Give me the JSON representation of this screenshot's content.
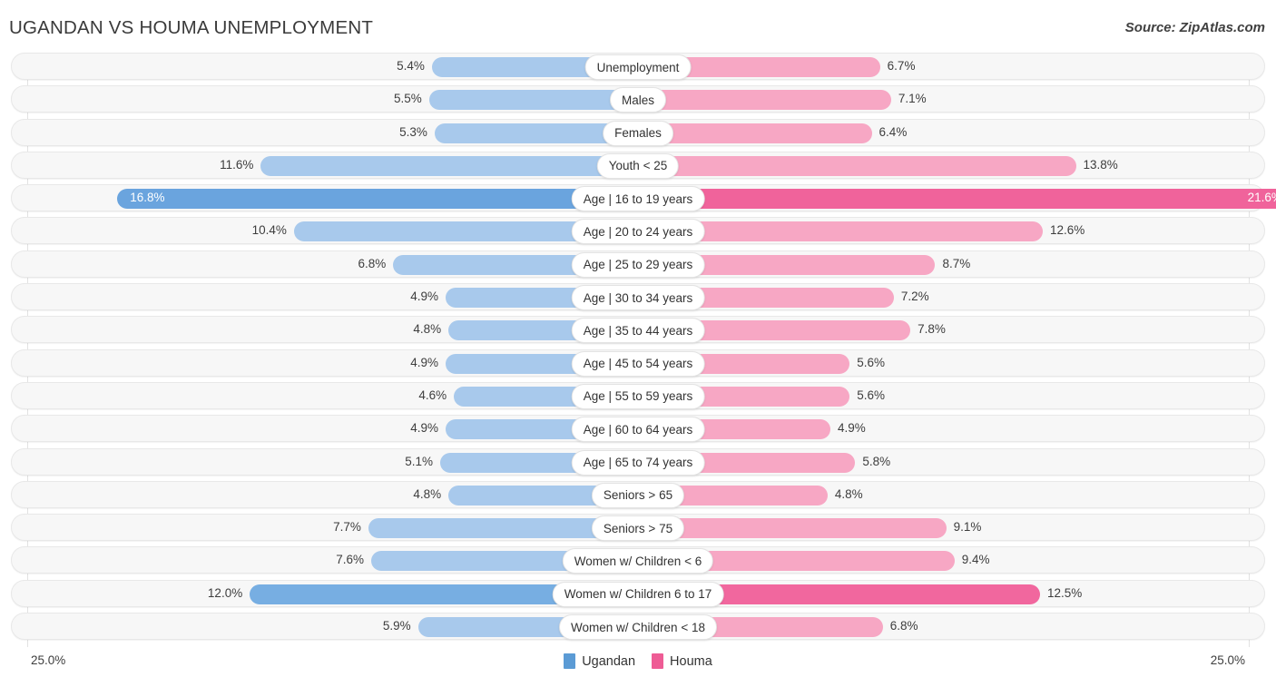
{
  "header": {
    "title": "UGANDAN VS HOUMA UNEMPLOYMENT",
    "source": "Source: ZipAtlas.com"
  },
  "footer": {
    "axis_left": "25.0%",
    "axis_right": "25.0%",
    "legend": [
      {
        "label": "Ugandan",
        "color": "#5b9bd5"
      },
      {
        "label": "Houma",
        "color": "#ee5c95"
      }
    ]
  },
  "chart_data": {
    "type": "bar",
    "subtype": "diverging-bidirectional",
    "title": "UGANDAN VS HOUMA UNEMPLOYMENT",
    "xlabel": "",
    "ylabel": "",
    "xlim": [
      -25.0,
      25.0
    ],
    "axis_tick_labels": [
      "25.0%",
      "25.0%"
    ],
    "grid": true,
    "legend_position": "bottom-center",
    "series": [
      {
        "name": "Ugandan",
        "color": "#5b9bd5",
        "side": "left",
        "values": [
          5.4,
          5.5,
          5.3,
          11.6,
          16.8,
          10.4,
          6.8,
          4.9,
          4.8,
          4.9,
          4.6,
          4.9,
          5.1,
          4.8,
          7.7,
          7.6,
          12.0,
          5.9
        ]
      },
      {
        "name": "Houma",
        "color": "#ee5c95",
        "side": "right",
        "values": [
          6.7,
          7.1,
          6.4,
          13.8,
          21.6,
          12.6,
          8.7,
          7.2,
          7.8,
          5.6,
          5.6,
          4.9,
          5.8,
          4.8,
          9.1,
          9.4,
          12.5,
          6.8
        ]
      }
    ],
    "categories": [
      "Unemployment",
      "Males",
      "Females",
      "Youth < 25",
      "Age | 16 to 19 years",
      "Age | 20 to 24 years",
      "Age | 25 to 29 years",
      "Age | 30 to 34 years",
      "Age | 35 to 44 years",
      "Age | 45 to 54 years",
      "Age | 55 to 59 years",
      "Age | 60 to 64 years",
      "Age | 65 to 74 years",
      "Seniors > 65",
      "Seniors > 75",
      "Women w/ Children < 6",
      "Women w/ Children 6 to 17",
      "Women w/ Children < 18"
    ],
    "rows": [
      {
        "label": "Unemployment",
        "left": 5.4,
        "right": 6.7,
        "left_text": "5.4%",
        "right_text": "6.7%",
        "style": "normal"
      },
      {
        "label": "Males",
        "left": 5.5,
        "right": 7.1,
        "left_text": "5.5%",
        "right_text": "7.1%",
        "style": "normal"
      },
      {
        "label": "Females",
        "left": 5.3,
        "right": 6.4,
        "left_text": "5.3%",
        "right_text": "6.4%",
        "style": "normal"
      },
      {
        "label": "Youth < 25",
        "left": 11.6,
        "right": 13.8,
        "left_text": "11.6%",
        "right_text": "13.8%",
        "style": "normal"
      },
      {
        "label": "Age | 16 to 19 years",
        "left": 16.8,
        "right": 21.6,
        "left_text": "16.8%",
        "right_text": "21.6%",
        "style": "highlight"
      },
      {
        "label": "Age | 20 to 24 years",
        "left": 10.4,
        "right": 12.6,
        "left_text": "10.4%",
        "right_text": "12.6%",
        "style": "normal"
      },
      {
        "label": "Age | 25 to 29 years",
        "left": 6.8,
        "right": 8.7,
        "left_text": "6.8%",
        "right_text": "8.7%",
        "style": "normal"
      },
      {
        "label": "Age | 30 to 34 years",
        "left": 4.9,
        "right": 7.2,
        "left_text": "4.9%",
        "right_text": "7.2%",
        "style": "normal"
      },
      {
        "label": "Age | 35 to 44 years",
        "left": 4.8,
        "right": 7.8,
        "left_text": "4.8%",
        "right_text": "7.8%",
        "style": "normal"
      },
      {
        "label": "Age | 45 to 54 years",
        "left": 4.9,
        "right": 5.6,
        "left_text": "4.9%",
        "right_text": "5.6%",
        "style": "normal"
      },
      {
        "label": "Age | 55 to 59 years",
        "left": 4.6,
        "right": 5.6,
        "left_text": "4.6%",
        "right_text": "5.6%",
        "style": "normal"
      },
      {
        "label": "Age | 60 to 64 years",
        "left": 4.9,
        "right": 4.9,
        "left_text": "4.9%",
        "right_text": "4.9%",
        "style": "normal"
      },
      {
        "label": "Age | 65 to 74 years",
        "left": 5.1,
        "right": 5.8,
        "left_text": "5.1%",
        "right_text": "5.8%",
        "style": "normal"
      },
      {
        "label": "Seniors > 65",
        "left": 4.8,
        "right": 4.8,
        "left_text": "4.8%",
        "right_text": "4.8%",
        "style": "normal"
      },
      {
        "label": "Seniors > 75",
        "left": 7.7,
        "right": 9.1,
        "left_text": "7.7%",
        "right_text": "9.1%",
        "style": "normal"
      },
      {
        "label": "Women w/ Children < 6",
        "left": 7.6,
        "right": 9.4,
        "left_text": "7.6%",
        "right_text": "9.4%",
        "style": "normal"
      },
      {
        "label": "Women w/ Children 6 to 17",
        "left": 12.0,
        "right": 12.5,
        "left_text": "12.0%",
        "right_text": "12.5%",
        "style": "highlight2"
      },
      {
        "label": "Women w/ Children < 18",
        "left": 5.9,
        "right": 6.8,
        "left_text": "5.9%",
        "right_text": "6.8%",
        "style": "normal"
      }
    ]
  }
}
